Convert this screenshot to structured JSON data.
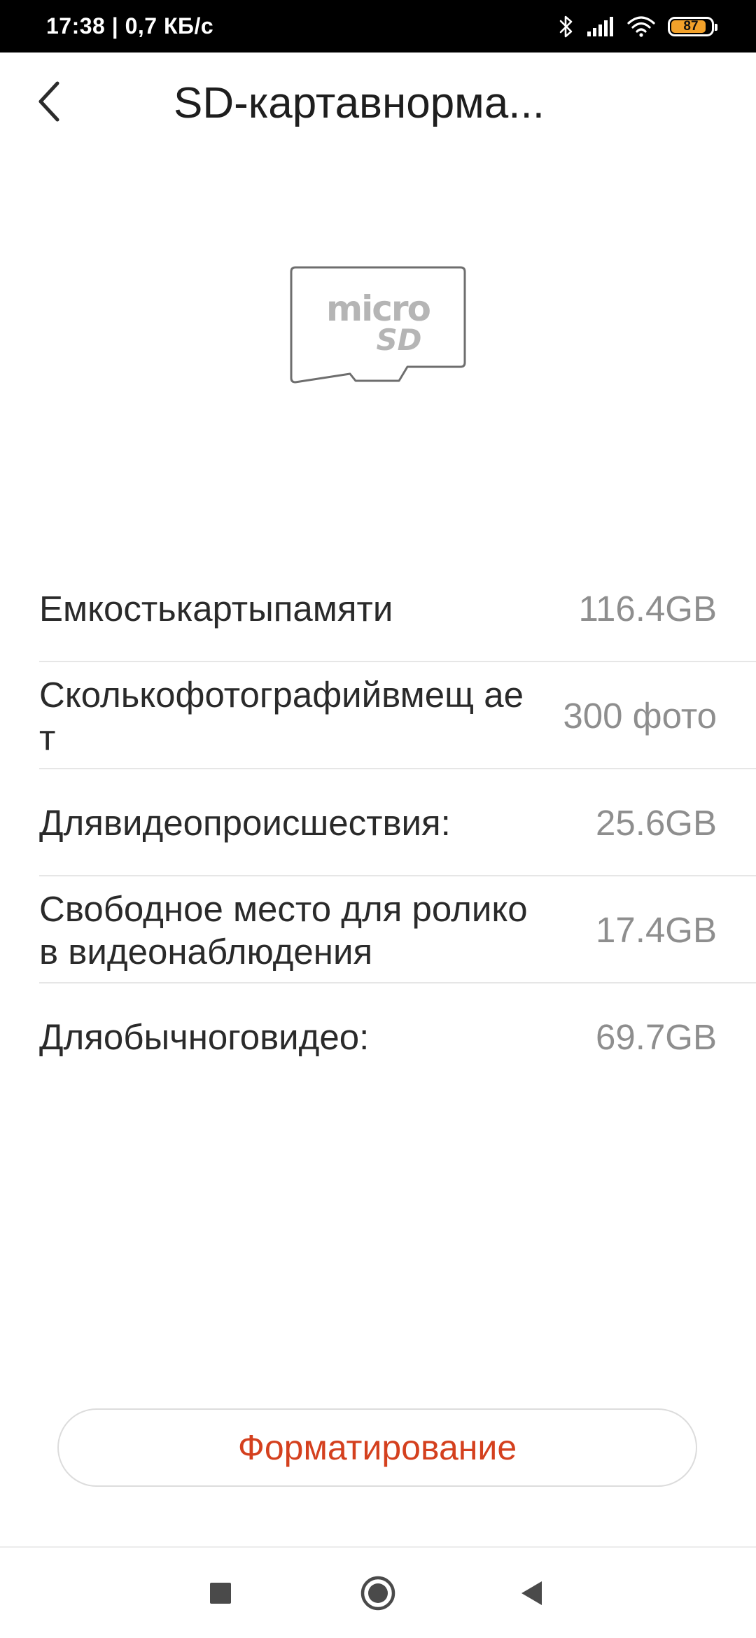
{
  "status_bar": {
    "time_speed": "17:38 | 0,7 КБ/с",
    "battery_level": "87",
    "battery_fraction": 0.87,
    "battery_color": "#f2a12a",
    "icons": [
      "bluetooth-icon",
      "signal-icon",
      "wifi-icon",
      "battery-icon"
    ]
  },
  "header": {
    "title": "SD-картавнорма...",
    "back_icon": "chevron-left-icon"
  },
  "sd_card": {
    "icon": "microsd-card-icon",
    "logo_text": "micro SD"
  },
  "info": {
    "rows": [
      {
        "label": "Емкостькартыпамяти",
        "value": "116.4GB"
      },
      {
        "label": "Сколькофотографийвмещ ает",
        "value": "300 фото"
      },
      {
        "label": "Длявидеопроисшествия:",
        "value": "25.6GB"
      },
      {
        "label": "Свободное место для роликов видеонаблюдения",
        "value": "17.4GB"
      },
      {
        "label": "Дляобычноговидео:",
        "value": "69.7GB"
      }
    ]
  },
  "actions": {
    "format_label": "Форматирование",
    "format_color": "#d4401e"
  },
  "nav_bar": {
    "icons": [
      "recents-square-icon",
      "home-circle-icon",
      "back-triangle-icon"
    ]
  }
}
